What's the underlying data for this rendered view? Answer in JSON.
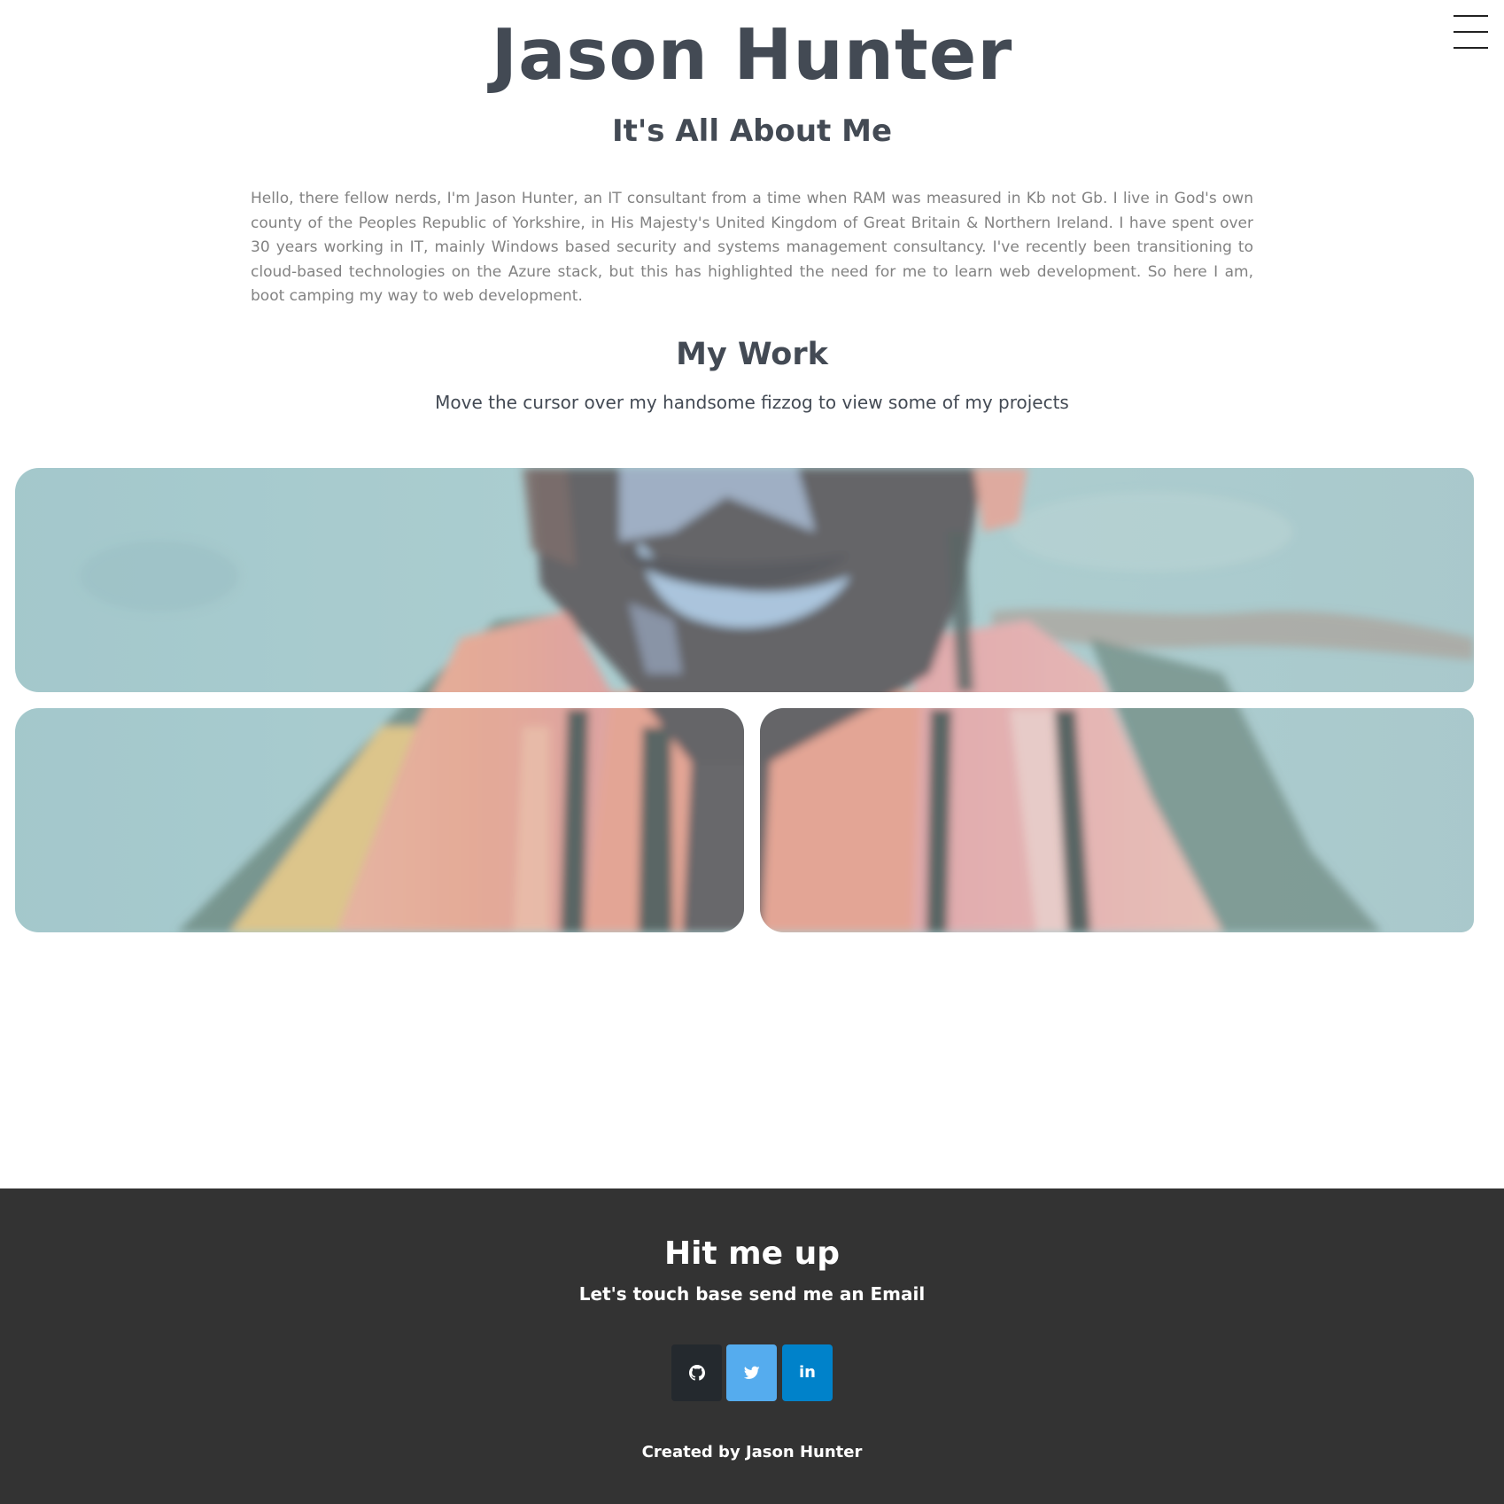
{
  "header": {
    "title": "Jason Hunter",
    "subtitle": "It's All About Me",
    "menu_icon": "hamburger-menu-icon"
  },
  "about": {
    "text": "Hello, there fellow nerds, I'm Jason Hunter, an IT consultant from a time when RAM was measured in Kb not Gb. I live in God's own county of the Peoples Republic of Yorkshire, in His Majesty's United Kingdom of Great Britain & Northern Ireland. I have spent over 30 years working in IT, mainly Windows based security and systems management consultancy. I've recently been transitioning to cloud-based technologies on the Azure stack, but this has highlighted the need for me to learn web development. So here I am, boot camping my way to web development."
  },
  "work": {
    "heading": "My Work",
    "note": "Move the cursor over my handsome fizzog to view some of my projects"
  },
  "footer": {
    "heading": "Hit me up",
    "subheading": "Let's touch base send me an Email",
    "social": [
      {
        "icon": "github-icon",
        "color": "#24292e"
      },
      {
        "icon": "twitter-icon",
        "color": "#55acee"
      },
      {
        "icon": "linkedin-icon",
        "label": "in",
        "color": "#0082ca"
      }
    ],
    "credit": "Created by Jason Hunter",
    "background": "#333333"
  },
  "colors": {
    "heading": "#434a54",
    "body_text": "#828282",
    "portrait_background": "#a7d3d6"
  }
}
